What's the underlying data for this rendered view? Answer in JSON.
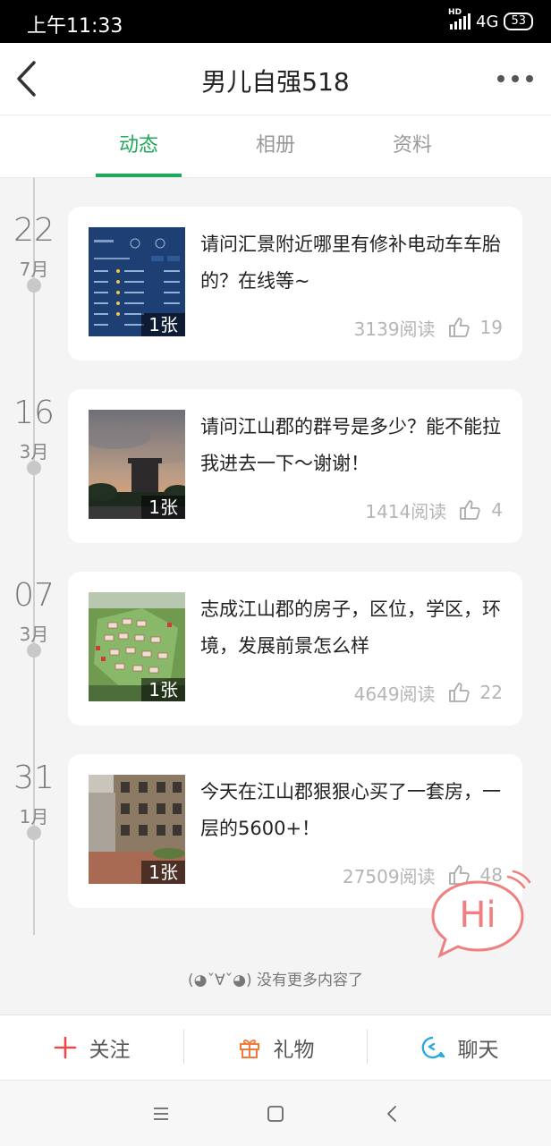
{
  "status_bar": {
    "time": "上午11:33",
    "network": "4G",
    "hd": "HD",
    "battery": "53"
  },
  "header": {
    "title": "男儿自强518",
    "back_icon": "chevron-left-icon",
    "more_icon": "more-dots-icon"
  },
  "tabs": [
    {
      "label": "动态",
      "active": true
    },
    {
      "label": "相册",
      "active": false
    },
    {
      "label": "资料",
      "active": false
    }
  ],
  "posts": [
    {
      "day": "22",
      "month": "7月",
      "text": "请问汇景附近哪里有修补电动车车胎的？在线等~",
      "photo_count": "1张",
      "reads": "3139阅读",
      "likes": "19"
    },
    {
      "day": "16",
      "month": "3月",
      "text": "请问江山郡的群号是多少？能不能拉我进去一下～谢谢！",
      "photo_count": "1张",
      "reads": "1414阅读",
      "likes": "4"
    },
    {
      "day": "07",
      "month": "3月",
      "text": "志成江山郡的房子，区位，学区，环境，发展前景怎么样",
      "photo_count": "1张",
      "reads": "4649阅读",
      "likes": "22"
    },
    {
      "day": "31",
      "month": "1月",
      "text": "今天在江山郡狠狠心买了一套房，一层的5600+！",
      "photo_count": "1张",
      "reads": "27509阅读",
      "likes": "48"
    }
  ],
  "footer_note": "(◕ˇ∀ˇ◕) 没有更多内容了",
  "hi_bubble": {
    "label": "Hi"
  },
  "action_bar": {
    "follow": {
      "label": "关注",
      "icon": "plus-icon",
      "color": "#e84a4a"
    },
    "gift": {
      "label": "礼物",
      "icon": "gift-icon",
      "color": "#f07a3a"
    },
    "chat": {
      "label": "聊天",
      "icon": "chat-icon",
      "color": "#2aa8e0"
    }
  },
  "colors": {
    "accent": "#1faa59",
    "hi": "#f07f7f"
  }
}
